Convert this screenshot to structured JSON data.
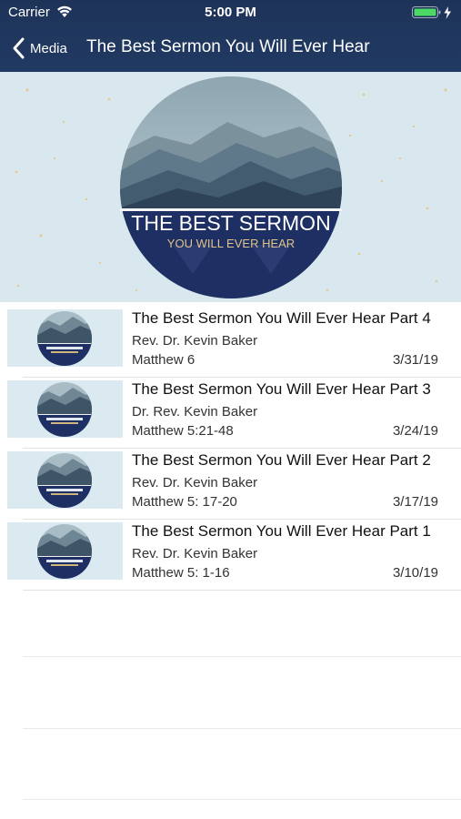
{
  "status_bar": {
    "carrier": "Carrier",
    "time": "5:00 PM",
    "icons": [
      "wifi-icon",
      "battery-icon",
      "charging-bolt-icon"
    ]
  },
  "nav": {
    "back_label": "Media",
    "title": "The Best Sermon You Will Ever Hear"
  },
  "banner": {
    "title_line1": "THE BEST SERMON",
    "title_line2": "YOU WILL EVER HEAR"
  },
  "sermons": [
    {
      "title": "The Best Sermon You Will Ever Hear Part 4",
      "speaker": "Rev. Dr. Kevin Baker",
      "passage": "Matthew 6",
      "date": "3/31/19"
    },
    {
      "title": "The Best Sermon You Will Ever Hear Part 3",
      "speaker": "Dr. Rev. Kevin Baker",
      "passage": "Matthew 5:21-48",
      "date": "3/24/19"
    },
    {
      "title": "The Best Sermon You Will Ever Hear Part 2",
      "speaker": "Rev. Dr. Kevin Baker",
      "passage": "Matthew 5: 17-20",
      "date": "3/17/19"
    },
    {
      "title": "The Best Sermon You Will Ever Hear Part 1",
      "speaker": "Rev. Dr. Kevin Baker",
      "passage": "Matthew 5: 1-16",
      "date": "3/10/19"
    }
  ],
  "colors": {
    "nav_bar": "#213a63",
    "banner_bg": "#d9e8ef",
    "badge_navy": "#1d2f63",
    "banner_subtitle": "#e0c489"
  }
}
